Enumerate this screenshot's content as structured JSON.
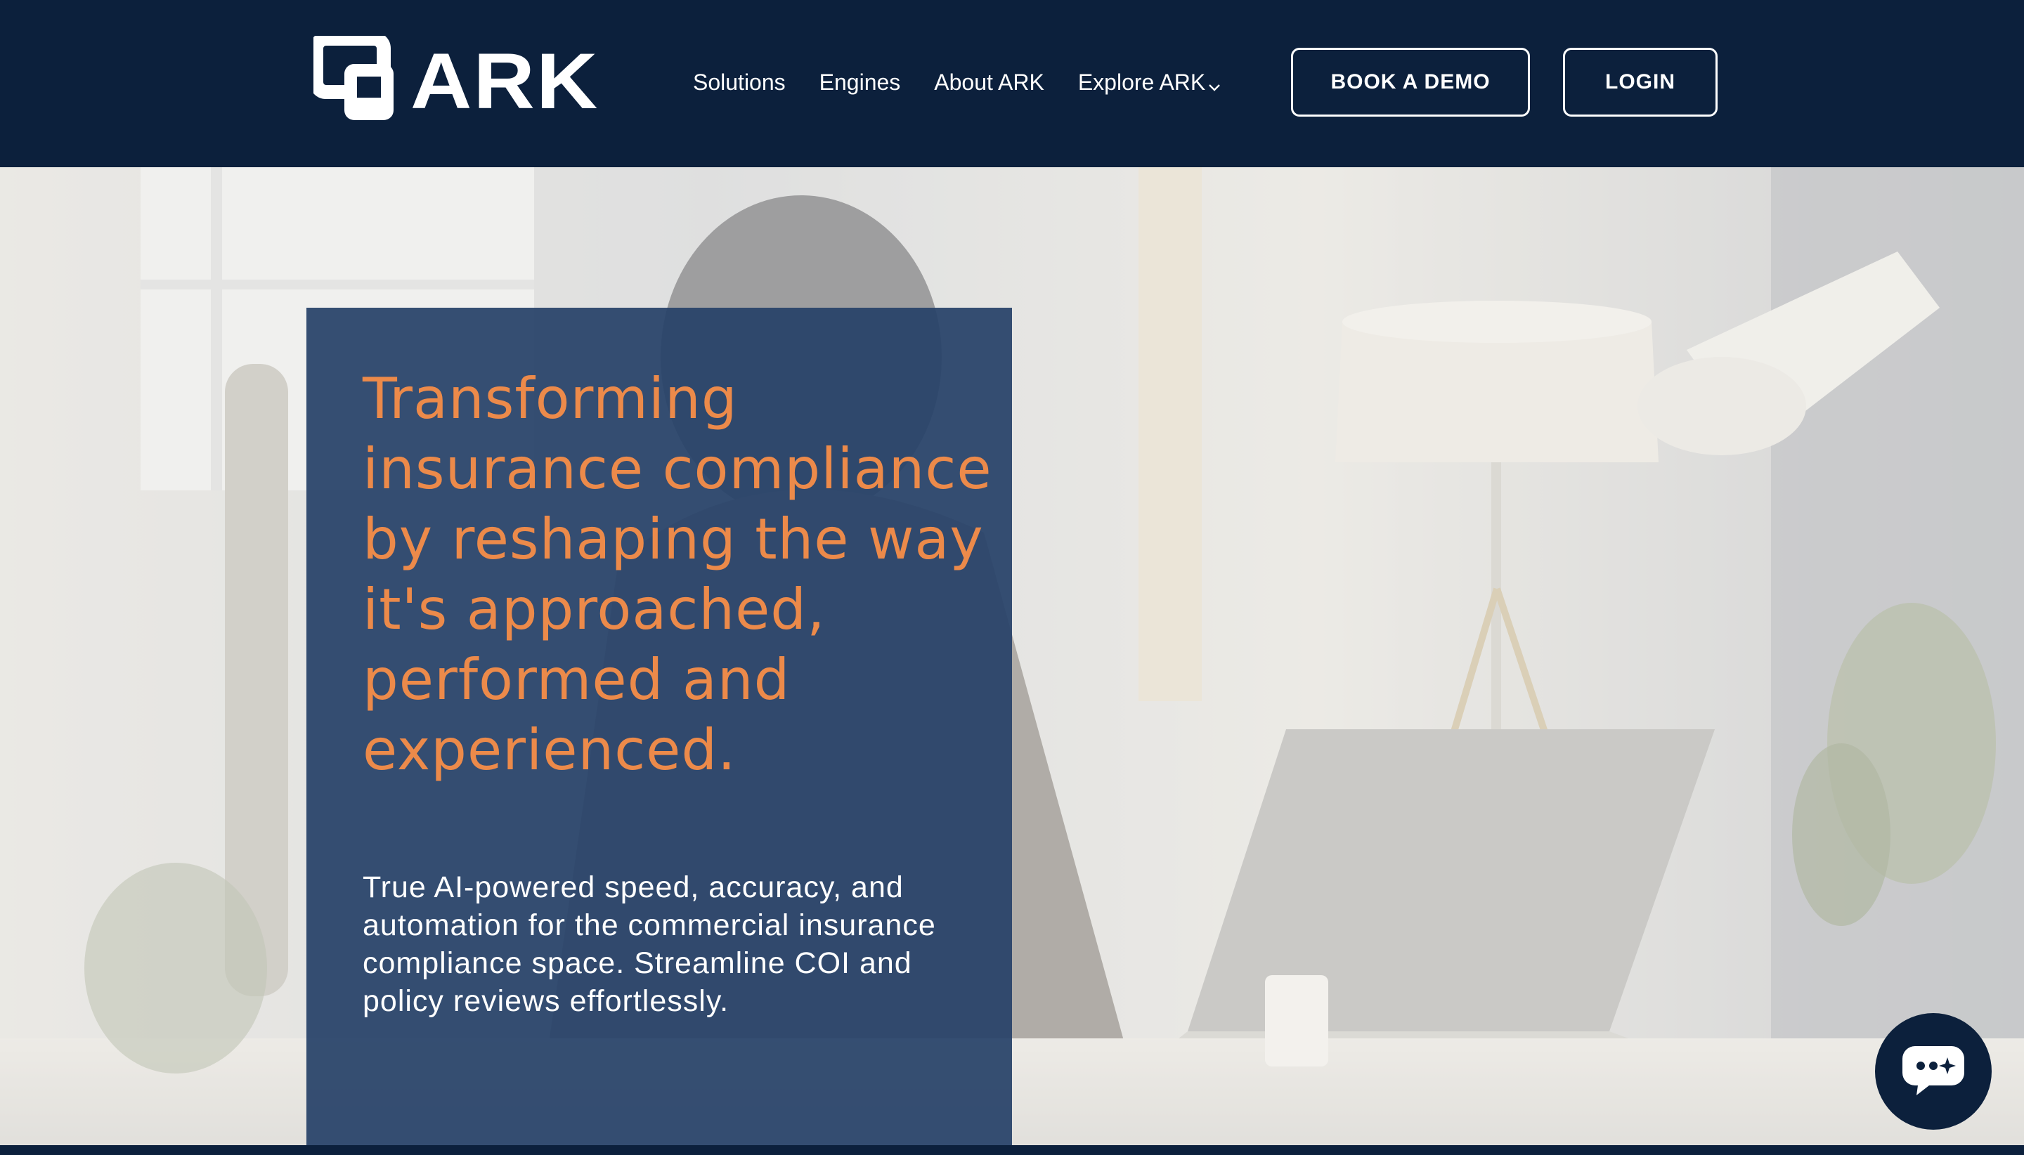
{
  "header": {
    "logo_text": "ARK",
    "nav": [
      {
        "label": "Solutions"
      },
      {
        "label": "Engines"
      },
      {
        "label": "About ARK"
      },
      {
        "label": "Explore ARK"
      }
    ],
    "book_demo_label": "BOOK A DEMO",
    "login_label": "LOGIN"
  },
  "hero": {
    "title": "Transforming insurance compliance by reshaping the way it's approached, performed and experienced.",
    "subtitle": "True AI-powered speed, accuracy, and automation for the commercial insurance compliance space. Streamline COI and policy reviews effortlessly."
  },
  "icons": {
    "logo_mark": "ark-logo-mark-icon",
    "dropdown": "chevron-down-icon",
    "chat": "chat-bubble-icon"
  },
  "colors": {
    "navy": "#0c203c",
    "card": "#274268",
    "accent_orange": "#ec8a4a",
    "white": "#ffffff"
  }
}
